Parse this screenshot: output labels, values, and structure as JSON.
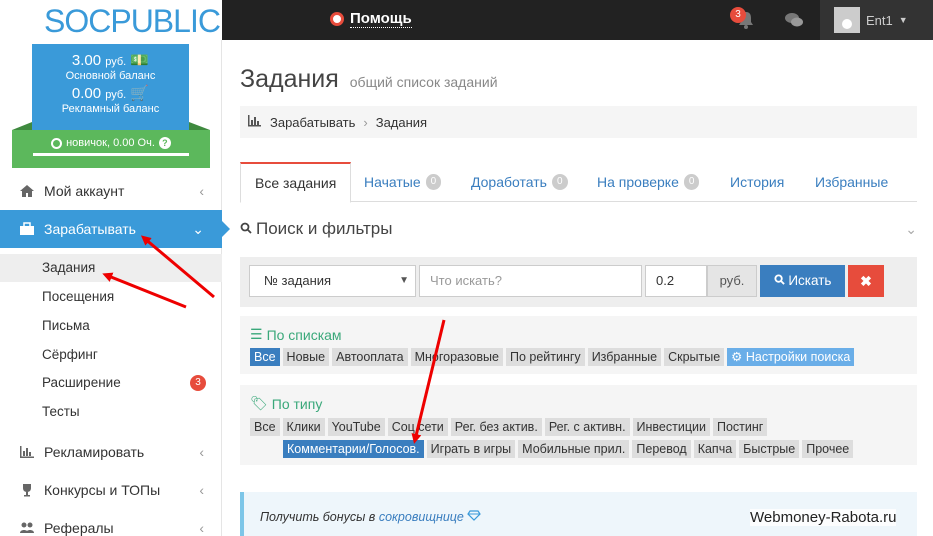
{
  "app": {
    "logo": "SOCPUBLIC",
    "help_label": "Помощь",
    "notifications_count": "3",
    "username": "Ent1"
  },
  "balance": {
    "main_amount": "3.00",
    "main_currency": "руб.",
    "main_label": "Основной баланс",
    "ad_amount": "0.00",
    "ad_currency": "руб.",
    "ad_label": "Рекламный баланс",
    "rank": "новичок, 0.00 Оч."
  },
  "sidebar": {
    "items": [
      {
        "label": "Мой аккаунт",
        "icon": "home-icon"
      },
      {
        "label": "Зарабатывать",
        "icon": "briefcase-icon",
        "active": true
      },
      {
        "label": "Рекламировать",
        "icon": "bar-chart-icon"
      },
      {
        "label": "Конкурсы и ТОПы",
        "icon": "trophy-icon"
      },
      {
        "label": "Рефералы",
        "icon": "users-icon"
      }
    ],
    "sub_items": [
      {
        "label": "Задания",
        "active": true
      },
      {
        "label": "Посещения"
      },
      {
        "label": "Письма"
      },
      {
        "label": "Сёрфинг"
      },
      {
        "label": "Расширение",
        "badge": "3"
      },
      {
        "label": "Тесты"
      }
    ]
  },
  "main": {
    "title": "Задания",
    "subtitle": "общий список заданий",
    "breadcrumb": [
      "Зарабатывать",
      "Задания"
    ],
    "tabs": [
      {
        "label": "Все задания",
        "active": true
      },
      {
        "label": "Начатые",
        "badge": "0"
      },
      {
        "label": "Доработать",
        "badge": "0"
      },
      {
        "label": "На проверке",
        "badge": "0"
      },
      {
        "label": "История"
      },
      {
        "label": "Избранные"
      }
    ],
    "filters_title": "Поиск и фильтры",
    "filter": {
      "select_value": "№ задания",
      "search_placeholder": "Что искать?",
      "amount": "0.2",
      "currency": "руб.",
      "search_button": "Искать",
      "clear_button": "✖"
    },
    "lists": {
      "title": "По спискам",
      "chips": [
        "Все",
        "Новые",
        "Автооплата",
        "Многоразовые",
        "По рейтингу",
        "Избранные",
        "Скрытые"
      ],
      "settings_chip": "Настройки поиска"
    },
    "types": {
      "title": "По типу",
      "row1": [
        "Все",
        "Клики",
        "YouTube",
        "Соц.сети",
        "Рег. без актив.",
        "Рег. с активн.",
        "Инвестиции",
        "Постинг"
      ],
      "row2_active": "Комментарии/Голосов.",
      "row2": [
        "Играть в игры",
        "Мобильные прил.",
        "Перевод",
        "Капча",
        "Быстрые",
        "Прочее"
      ]
    },
    "info": {
      "text": "Получить бонусы в",
      "link": "сокровищнице"
    }
  },
  "watermark": "Webmoney-Rabota.ru",
  "colors": {
    "primary": "#3a9ad9",
    "success": "#5cb85c",
    "danger": "#e74c3c",
    "topbar": "#222222"
  }
}
